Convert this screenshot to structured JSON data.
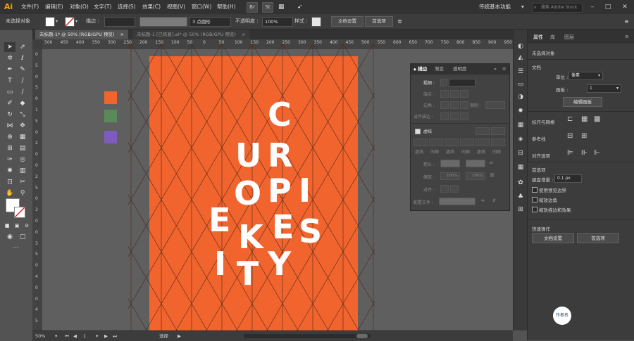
{
  "app": {
    "logo": "Ai"
  },
  "menu": {
    "items": [
      "文件(F)",
      "编辑(E)",
      "对象(O)",
      "文字(T)",
      "选择(S)",
      "效果(C)",
      "视图(V)",
      "窗口(W)",
      "帮助(H)"
    ],
    "bridge": "Br",
    "stock": "St",
    "workspace": "传统基本功能",
    "search_placeholder": "搜索 Adobe Stock"
  },
  "control": {
    "no_selection": "未选择对象",
    "stroke_label": "描边 :",
    "brush": "3 点圆形",
    "opacity_label": "不透明度 :",
    "opacity_value": "100%",
    "style_label": "样式 :",
    "doc_setup": "文档设置",
    "prefs": "首选项"
  },
  "tabs": [
    {
      "label": "未标题-1* @ 50% (RGB/GPU 预览)",
      "close": "×"
    },
    {
      "label": "未标题-1 [已恢复].ai* @ 50% (RGB/GPU 预览)",
      "close": "×"
    }
  ],
  "ruler_top": [
    "500",
    "450",
    "400",
    "350",
    "300",
    "250",
    "200",
    "150",
    "100",
    "50",
    "0",
    "50",
    "100",
    "150",
    "200",
    "250",
    "300",
    "350",
    "400",
    "450",
    "500",
    "550",
    "600",
    "650",
    "700",
    "750",
    "800",
    "850",
    "900",
    "950"
  ],
  "ruler_left": [
    "0",
    "5",
    "0",
    "5",
    "0",
    "1",
    "5",
    "0",
    "2",
    "0",
    "0",
    "2",
    "5",
    "0",
    "3",
    "0",
    "0",
    "3",
    "5",
    "0",
    "4",
    "0",
    "0",
    "4",
    "5"
  ],
  "swatches": [
    "#f2642e",
    "#5a8a5a",
    "#7e5bbf"
  ],
  "poster": {
    "background": "#f2642e",
    "letters": [
      "C",
      "U",
      "R",
      "O",
      "O",
      "P",
      "I",
      "E",
      "K",
      "E",
      "S",
      "I",
      "T",
      "Y"
    ]
  },
  "stroke_panel": {
    "tabs": [
      "描边",
      "渐变",
      "透明度"
    ],
    "weight_label": "粗细 :",
    "cap_label": "端点 :",
    "corner_label": "边角 :",
    "limit_label": "限制 :",
    "align_label": "对齐描边 :",
    "dashed_label": "虚线",
    "dash_cols": [
      "虚线",
      "间隙",
      "虚线",
      "间隙",
      "虚线",
      "间隙"
    ],
    "arrow_label": "箭头 :",
    "scale_label": "缩放 :",
    "scale_value_1": "100%",
    "scale_value_2": "100%",
    "align_row_label": "对齐 :",
    "profile_label": "配置文件 :"
  },
  "properties": {
    "tabs": [
      "属性",
      "库",
      "图层"
    ],
    "no_selection": "未选择对象",
    "document": "文档",
    "units_label": "单位 :",
    "units_value": "像素",
    "artboard_label": "画板 :",
    "artboard_value": "1",
    "edit_artboards": "编辑画板",
    "rulers_grids": "标尺与网格",
    "guides": "参考线",
    "snap": "对齐选项",
    "preferences": "首选项",
    "kbd_increment_label": "键盘增量 :",
    "kbd_increment_value": "0.1 px",
    "checkboxes": [
      "使用预览边界",
      "缩放边角",
      "缩放描边和效果"
    ],
    "quick_actions": "快速操作",
    "doc_setup_btn": "文档设置",
    "prefs_btn": "首选项"
  },
  "status": {
    "zoom": "50%",
    "artboard_num": "1",
    "tool": "选择"
  },
  "watermark": {
    "text": "作者名"
  }
}
